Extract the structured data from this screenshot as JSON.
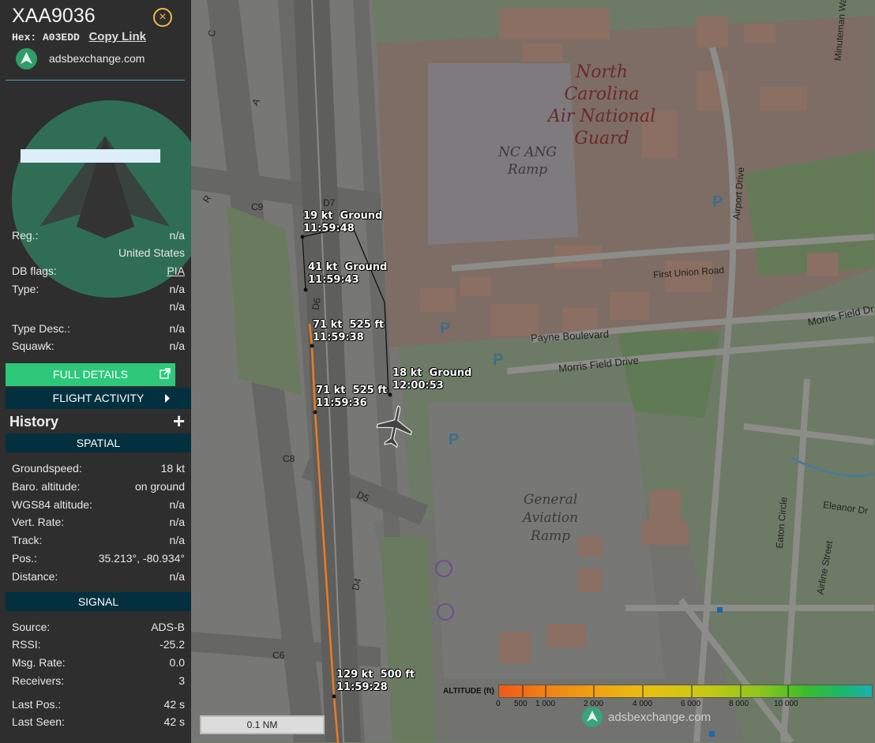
{
  "panel": {
    "callsign": "XAA9036",
    "close_icon": "×",
    "hex": "Hex: A03EDD",
    "copy_link": "Copy Link",
    "site": "adsbexchange.com",
    "info": [
      {
        "k": "Reg.:",
        "v": "n/a"
      },
      {
        "k": "",
        "v": "United States"
      },
      {
        "k": "DB flags:",
        "v": "PIA"
      },
      {
        "k": "Type:",
        "v": "n/a"
      },
      {
        "k": "",
        "v": "n/a"
      },
      {
        "k": "Type Desc.:",
        "v": "n/a"
      },
      {
        "k": "Squawk:",
        "v": "n/a"
      }
    ],
    "full_details": "FULL DETAILS",
    "flight_activity": "FLIGHT ACTIVITY",
    "history": "History",
    "history_plus": "+",
    "spatial_head": "SPATIAL",
    "spatial": [
      {
        "k": "Groundspeed:",
        "v": "18 kt"
      },
      {
        "k": "Baro. altitude:",
        "v": "on ground"
      },
      {
        "k": "WGS84 altitude:",
        "v": "n/a"
      },
      {
        "k": "Vert. Rate:",
        "v": "n/a"
      },
      {
        "k": "Track:",
        "v": "n/a"
      },
      {
        "k": "Pos.:",
        "v": "35.213°, -80.934°"
      },
      {
        "k": "Distance:",
        "v": "n/a"
      }
    ],
    "signal_head": "SIGNAL",
    "signal": [
      {
        "k": "Source:",
        "v": "ADS-B"
      },
      {
        "k": "RSSI:",
        "v": "-25.2"
      },
      {
        "k": "Msg. Rate:",
        "v": "0.0"
      },
      {
        "k": "Receivers:",
        "v": "3"
      },
      {
        "k": "Last Pos.:",
        "v": "42 s"
      },
      {
        "k": "Last Seen:",
        "v": "42 s"
      }
    ]
  },
  "map": {
    "track_labels": [
      {
        "l1": "19 kt  Ground",
        "l2": "11:59:48"
      },
      {
        "l1": "41 kt  Ground",
        "l2": "11:59:43"
      },
      {
        "l1": "71 kt  525 ft",
        "l2": "11:59:38"
      },
      {
        "l1": "71 kt  525 ft",
        "l2": "11:59:36"
      },
      {
        "l1": "18 kt  Ground",
        "l2": "12:00:53"
      },
      {
        "l1": "129 kt  500 ft",
        "l2": "11:59:28"
      }
    ],
    "places": {
      "ncang_l1": "North Carolina",
      "ncang_l2": "Air National",
      "ncang_l3": "Guard",
      "ramp_l1": "NC ANG",
      "ramp_l2": "Ramp",
      "ga_l1": "General",
      "ga_l2": "Aviation",
      "ga_l3": "Ramp",
      "payne": "Payne Boulevard",
      "morris": "Morris Field Drive",
      "morris2": "Morris Field Dr",
      "first_union": "First Union Road",
      "airport_drive": "Airport Drive",
      "eaton": "Eaton Circle",
      "airline": "Airline Street",
      "eleanor": "Eleanor Dr",
      "minuteman": "Minuteman Wa",
      "taxi_c9": "C9",
      "taxi_c8": "C8",
      "taxi_c6": "C6",
      "taxi_d7": "D7",
      "taxi_d6": "D6",
      "taxi_d5": "D5",
      "taxi_d4": "D4",
      "taxi_a": "A",
      "taxi_c": "C",
      "taxi_r": "R"
    },
    "scale": "0.1 NM",
    "altitude_label": "ALTITUDE (ft)",
    "altitude_ticks": [
      "0",
      "500",
      "1 000",
      "2 000",
      "4 000",
      "6 000",
      "8 000",
      "10 000"
    ],
    "watermark": "adsbexchange.com",
    "track_color": "#f07a20"
  }
}
